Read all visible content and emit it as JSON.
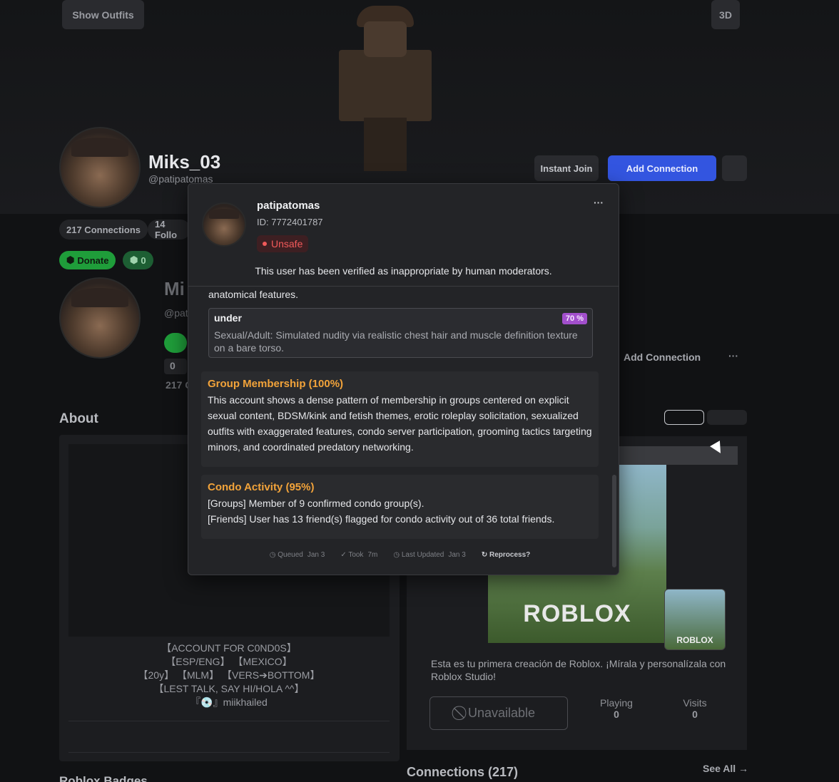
{
  "header": {
    "show_outfits": "Show Outfits",
    "view_3d": "3D"
  },
  "profile": {
    "display_name": "Miks_03",
    "username": "@patipatomas",
    "connections_chip": "217 Connections",
    "followers_chip": "14 Follo",
    "donate": "Donate",
    "robux_count": "0",
    "instant_join": "Instant Join",
    "add_connection": "Add Connection",
    "second_name_partial": "Mi",
    "second_handle_partial": "@pat",
    "second_add_connection": "Add Connection",
    "second_count_zero": "0",
    "second_connections_partial": "217 C"
  },
  "about": {
    "title": "About",
    "bio_lines": [
      "【ACCOUNT FOR C0ND0S】",
      "【ESP/ENG】 【MEXICO】",
      "【20y】 【MLM】 【VERS➔BOTTOM】",
      "【LEST TALK, SAY HI/HOLA ^^】",
      "『💿』miikhailed"
    ],
    "badges_title": "Roblox Badges"
  },
  "game": {
    "logo_text": "ROBLOX",
    "mini_logo_text": "ROBLOX",
    "description": "Esta es tu primera creación de Roblox. ¡Mírala y personalízala con Roblox Studio!",
    "unavailable": "Unavailable",
    "playing_label": "Playing",
    "playing_value": "0",
    "visits_label": "Visits",
    "visits_value": "0"
  },
  "connections": {
    "title": "Connections (217)",
    "see_all": "See All →"
  },
  "popup": {
    "username": "patipatomas",
    "user_id": "ID: 7772401787",
    "status": "Unsafe",
    "message": "This user has been verified as inappropriate by human moderators.",
    "menu": "···",
    "truncated_text": "anatomical features.",
    "flag": {
      "title": "under",
      "confidence": "70 %",
      "text": "Sexual/Adult: Simulated nudity via realistic chest hair and muscle definition texture on a bare torso."
    },
    "group_membership": {
      "title": "Group Membership (100%)",
      "text": "This account shows a dense pattern of membership in groups centered on explicit sexual content, BDSM/kink and fetish themes, erotic roleplay solicitation, sexualized outfits with exaggerated features, condo server participation, grooming tactics targeting minors, and coordinated predatory networking."
    },
    "condo_activity": {
      "title": "Condo Activity (95%)",
      "line1": "[Groups] Member of 9 confirmed condo group(s).",
      "line2": "[Friends] User has 13 friend(s) flagged for condo activity out of 36 total friends."
    },
    "footer": {
      "queued_label": "Queued",
      "queued_value": "Jan 3",
      "took_label": "Took",
      "took_value": "7m",
      "updated_label": "Last Updated",
      "updated_value": "Jan 3",
      "reprocess": "Reprocess?"
    }
  },
  "colors": {
    "accent_blue": "#3355e0",
    "unsafe_red": "#f25a5a",
    "category_orange": "#f2a33a",
    "confidence_purple": "#a24fcc",
    "donate_green": "#1f9d3a"
  }
}
